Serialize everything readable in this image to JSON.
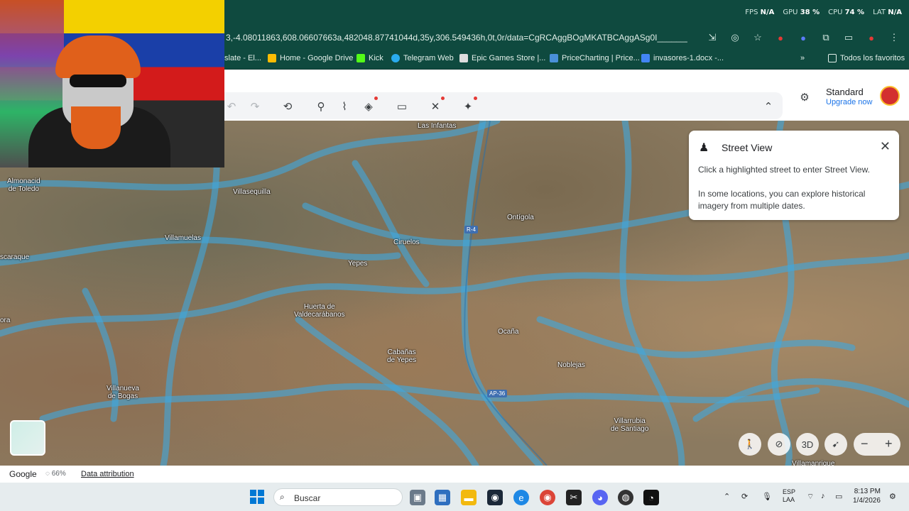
{
  "perf": {
    "fps_label": "FPS",
    "fps_value": "N/A",
    "gpu_label": "GPU",
    "gpu_value": "38 %",
    "cpu_label": "CPU",
    "cpu_value": "74 %",
    "lat_label": "LAT",
    "lat_value": "N/A"
  },
  "browser": {
    "url": "3,-4.08011863,608.06607663a,482048.87741044d,35y,306.549436h,0t,0r/data=CgRCAggBOgMKATBCAggASg0I________AR...",
    "bookmarks": [
      {
        "label": "slate - El..."
      },
      {
        "label": "Home - Google Drive"
      },
      {
        "label": "Kick"
      },
      {
        "label": "Telegram Web"
      },
      {
        "label": "Epic Games Store |..."
      },
      {
        "label": "PriceCharting | Price..."
      },
      {
        "label": "invasores-1.docx -..."
      }
    ],
    "more_label": "»",
    "all_bookmarks_label": "Todos los favoritos"
  },
  "maps": {
    "plan_name": "Standard",
    "upgrade_label": "Upgrade now",
    "places": [
      {
        "name": "Las Infantas"
      },
      {
        "name": "Almonacid\nde Toledo"
      },
      {
        "name": "Villasequilla"
      },
      {
        "name": "Villamuelas"
      },
      {
        "name": "Ciruelos"
      },
      {
        "name": "Ontígola"
      },
      {
        "name": "Yepes"
      },
      {
        "name": "scaraque"
      },
      {
        "name": "Huerta de\nValdecarábanos"
      },
      {
        "name": "Ocaña"
      },
      {
        "name": "Cabañas\nde Yepes"
      },
      {
        "name": "Noblejas"
      },
      {
        "name": "Villanueva\nde Bogas"
      },
      {
        "name": "Villarrubia\nde Santiago"
      },
      {
        "name": "ora"
      },
      {
        "name": "Villamanrique"
      }
    ],
    "shields": [
      {
        "label": "R-4"
      },
      {
        "label": "AP-36"
      }
    ],
    "street_view": {
      "title": "Street View",
      "text1": "Click a highlighted street to enter Street View.",
      "text2": "In some locations, you can explore historical imagery from multiple dates."
    },
    "controls": {
      "three_d_label": "3D",
      "zoom_out": "−",
      "zoom_in": "+"
    },
    "footer": {
      "google_label": "Google",
      "loading_value": "66%",
      "attribution_label": "Data attribution"
    }
  },
  "taskbar": {
    "search_placeholder": "Buscar",
    "lang_top": "ESP",
    "lang_bottom": "LAA",
    "time": "8:13 PM",
    "date": "1/4/2026"
  }
}
